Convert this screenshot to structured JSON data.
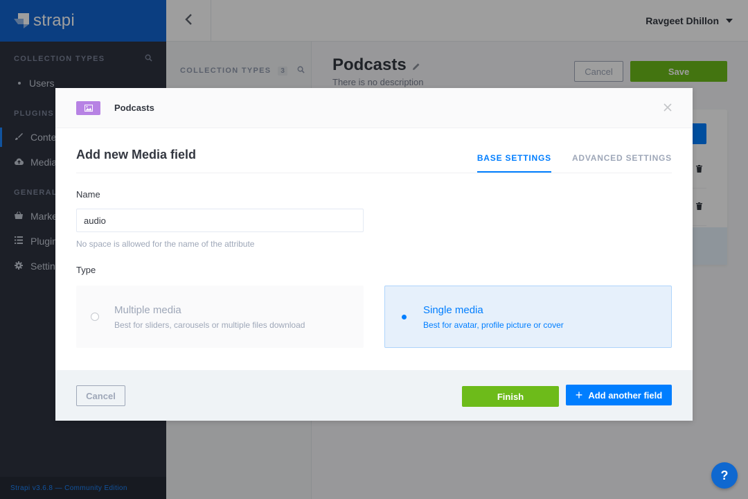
{
  "brand": {
    "name": "strapi"
  },
  "main_sidebar": {
    "sections": [
      {
        "title": "COLLECTION TYPES",
        "items": [
          {
            "label": "Users",
            "icon": "bullet"
          }
        ]
      },
      {
        "title": "PLUGINS",
        "items": [
          {
            "label": "Content-Types Builder",
            "icon": "paint-brush-icon",
            "active": true
          },
          {
            "label": "Media Library",
            "icon": "cloud-upload-icon"
          }
        ]
      },
      {
        "title": "GENERAL",
        "items": [
          {
            "label": "Marketplace",
            "icon": "basket-icon"
          },
          {
            "label": "Plugins",
            "icon": "list-icon"
          },
          {
            "label": "Settings",
            "icon": "gear-icon"
          }
        ]
      }
    ],
    "footer": "Strapi v3.6.8 — Community Edition"
  },
  "header": {
    "user_name": "Ravgeet Dhillon"
  },
  "subnav": {
    "title": "COLLECTION TYPES",
    "count": "3"
  },
  "editor": {
    "title": "Podcasts",
    "description": "There is no description",
    "cancel_label": "Cancel",
    "save_label": "Save"
  },
  "modal": {
    "content_type": "Podcasts",
    "title": "Add new Media field",
    "tabs": [
      {
        "label": "BASE SETTINGS",
        "active": true
      },
      {
        "label": "ADVANCED SETTINGS",
        "active": false
      }
    ],
    "name_label": "Name",
    "name_value": "audio",
    "name_hint": "No space is allowed for the name of the attribute",
    "type_label": "Type",
    "type_options": [
      {
        "title": "Multiple media",
        "description": "Best for sliders, carousels or multiple files download",
        "selected": false
      },
      {
        "title": "Single media",
        "description": "Best for avatar, profile picture or cover",
        "selected": true
      }
    ],
    "cancel_label": "Cancel",
    "finish_label": "Finish",
    "add_another_label": "Add another field"
  },
  "help": {
    "label": "?"
  },
  "colors": {
    "brand_blue": "#1264d0",
    "primary_blue": "#007eff",
    "success_green": "#6dbb1a",
    "sidebar_bg": "#2e3240",
    "media_badge": "#b782e4"
  }
}
